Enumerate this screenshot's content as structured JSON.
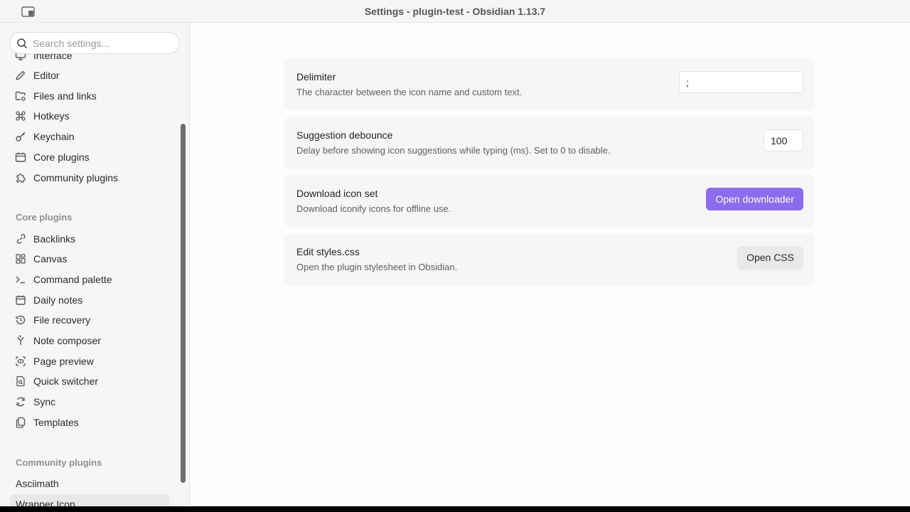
{
  "window": {
    "title": "Settings - plugin-test - Obsidian 1.13.7"
  },
  "sidebar": {
    "search_placeholder": "Search settings...",
    "options_items": [
      {
        "label": "Interface",
        "icon": "monitor-icon"
      },
      {
        "label": "Editor",
        "icon": "pencil-icon"
      },
      {
        "label": "Files and links",
        "icon": "folder-cog-icon"
      },
      {
        "label": "Hotkeys",
        "icon": "command-icon"
      },
      {
        "label": "Keychain",
        "icon": "key-icon"
      },
      {
        "label": "Core plugins",
        "icon": "calendar-box-icon"
      },
      {
        "label": "Community plugins",
        "icon": "puzzle-icon"
      }
    ],
    "core_plugins_label": "Core plugins",
    "core_plugins": [
      {
        "label": "Backlinks",
        "icon": "links-coming-in-icon"
      },
      {
        "label": "Canvas",
        "icon": "layout-dashboard-icon"
      },
      {
        "label": "Command palette",
        "icon": "terminal-icon"
      },
      {
        "label": "Daily notes",
        "icon": "calendar-icon"
      },
      {
        "label": "File recovery",
        "icon": "history-icon"
      },
      {
        "label": "Note composer",
        "icon": "merge-icon"
      },
      {
        "label": "Page preview",
        "icon": "scan-eye-icon"
      },
      {
        "label": "Quick switcher",
        "icon": "file-search-icon"
      },
      {
        "label": "Sync",
        "icon": "refresh-icon"
      },
      {
        "label": "Templates",
        "icon": "files-icon"
      }
    ],
    "community_plugins_label": "Community plugins",
    "community_plugins": [
      {
        "label": "Asciimath"
      },
      {
        "label": "Wrapper Icon"
      }
    ]
  },
  "settings": {
    "delimiter": {
      "name": "Delimiter",
      "desc": "The character between the icon name and custom text.",
      "value": ";"
    },
    "debounce": {
      "name": "Suggestion debounce",
      "desc": "Delay before showing icon suggestions while typing (ms). Set to 0 to disable.",
      "value": "100"
    },
    "download": {
      "name": "Download icon set",
      "desc": "Download iconify icons for offline use.",
      "button": "Open downloader"
    },
    "styles": {
      "name": "Edit styles.css",
      "desc": "Open the plugin stylesheet in Obsidian.",
      "button": "Open CSS"
    }
  },
  "colors": {
    "accent": "#8b6cef",
    "sidebar_bg": "#f6f6f6",
    "card_bg": "#f6f6f6"
  }
}
